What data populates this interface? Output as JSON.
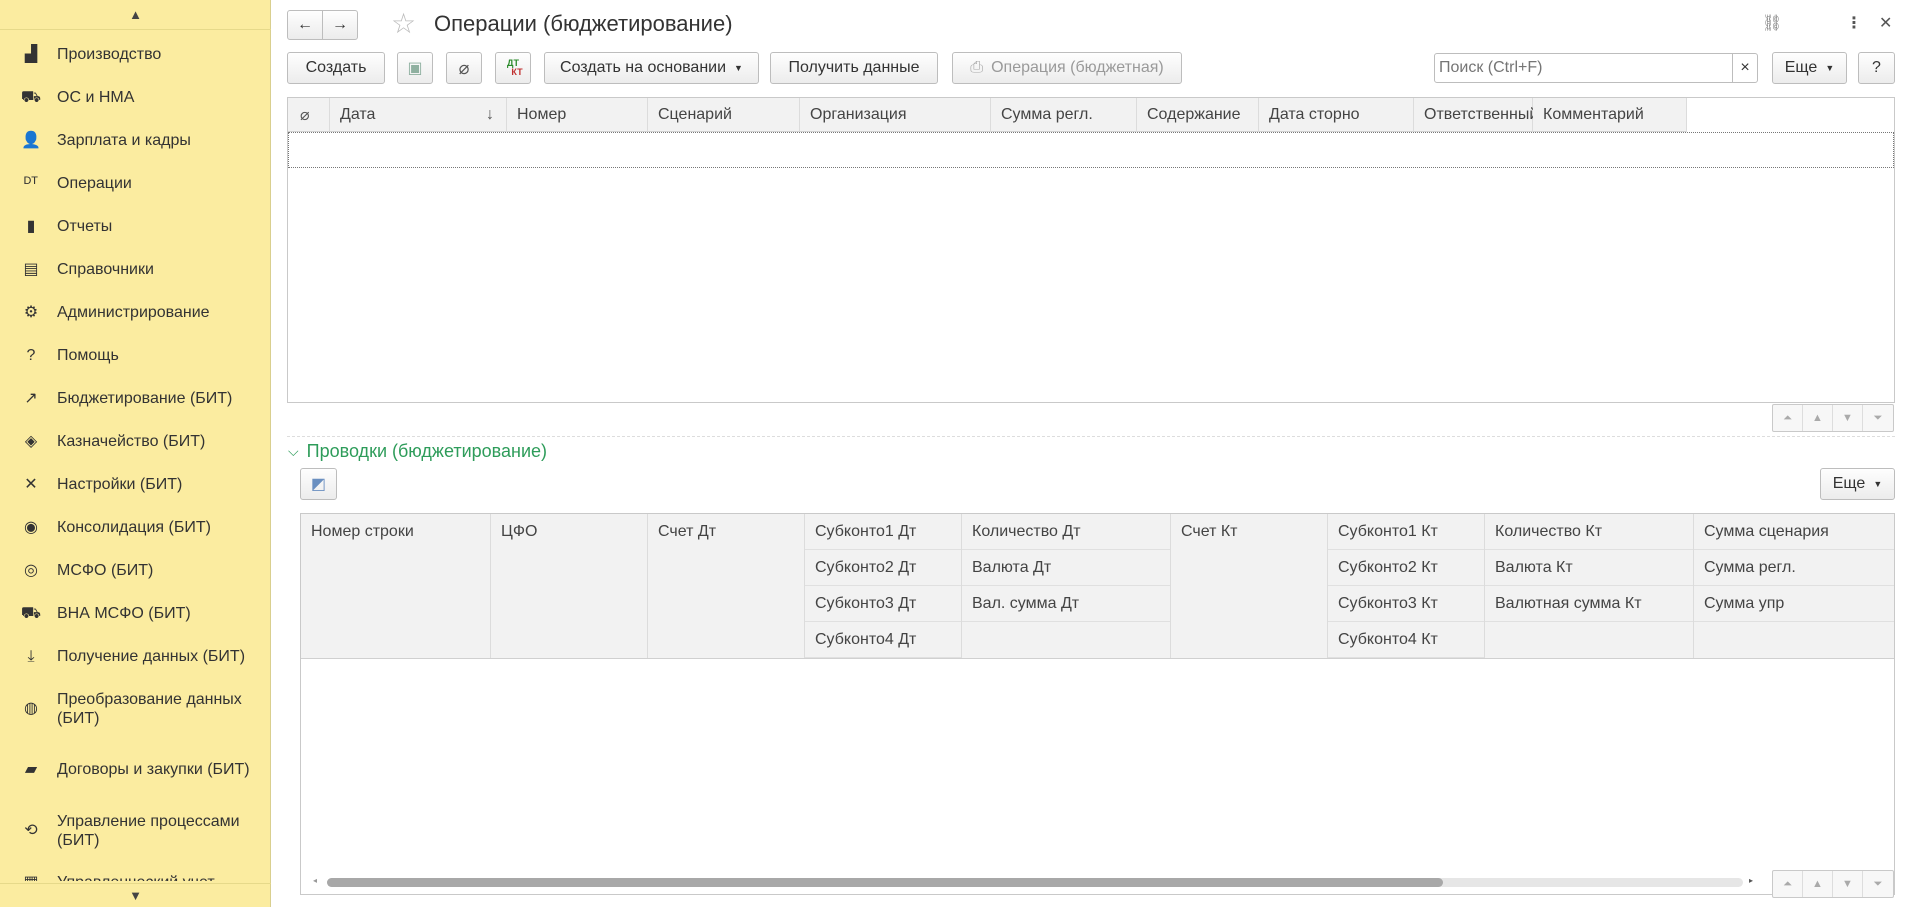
{
  "sidebar": {
    "items": [
      {
        "label": "Производство",
        "icon": "factory-icon",
        "glyph": "▟"
      },
      {
        "label": "ОС и НМА",
        "icon": "truck-icon",
        "glyph": "⛟"
      },
      {
        "label": "Зарплата и кадры",
        "icon": "person-icon",
        "glyph": "👤"
      },
      {
        "label": "Операции",
        "icon": "dt-kt-icon",
        "glyph": "ᴰᵀ"
      },
      {
        "label": "Отчеты",
        "icon": "bar-chart-icon",
        "glyph": "▮"
      },
      {
        "label": "Справочники",
        "icon": "books-icon",
        "glyph": "▤"
      },
      {
        "label": "Администрирование",
        "icon": "gear-icon",
        "glyph": "⚙"
      },
      {
        "label": "Помощь",
        "icon": "question-icon",
        "glyph": "?"
      },
      {
        "label": "Бюджетирование (БИТ)",
        "icon": "trend-chart-icon",
        "glyph": "↗"
      },
      {
        "label": "Казначейство (БИТ)",
        "icon": "money-icon",
        "glyph": "◈"
      },
      {
        "label": "Настройки (БИТ)",
        "icon": "tools-icon",
        "glyph": "✕"
      },
      {
        "label": "Консолидация (БИТ)",
        "icon": "globe-dark-icon",
        "glyph": "◉"
      },
      {
        "label": "МСФО (БИТ)",
        "icon": "globe-icon",
        "glyph": "◎"
      },
      {
        "label": "ВНА МСФО (БИТ)",
        "icon": "truck-icon",
        "glyph": "⛟"
      },
      {
        "label": "Получение данных (БИТ)",
        "icon": "download-icon",
        "glyph": "⤓"
      },
      {
        "label": "Преобразование данных (БИТ)",
        "icon": "transform-icon",
        "glyph": "◍",
        "tall": true
      },
      {
        "label": "Договоры и закупки (БИТ)",
        "icon": "folder-icon",
        "glyph": "▰",
        "tall": true
      },
      {
        "label": "Управление процессами (БИТ)",
        "icon": "process-icon",
        "glyph": "⟲",
        "tall": true
      },
      {
        "label": "Управленческий учет",
        "icon": "accounting-icon",
        "glyph": "▦"
      }
    ]
  },
  "header": {
    "title": "Операции (бюджетирование)",
    "back": "←",
    "forward": "→",
    "star": "☆",
    "link": "🔗",
    "more": "⋮",
    "close": "✕"
  },
  "toolbar": {
    "create": "Создать",
    "dt_kt": "Дт Кт",
    "create_based": "Создать на основании",
    "get_data": "Получить данные",
    "print_op": "Операция (бюджетная)",
    "search_placeholder": "Поиск (Ctrl+F)",
    "clear": "×",
    "more": "Еще",
    "help": "?"
  },
  "main_table": {
    "columns": [
      "Дата",
      "Номер",
      "Сценарий",
      "Организация",
      "Сумма регл.",
      "Содержание",
      "Дата сторно",
      "Ответственный",
      "Комментарий"
    ],
    "sort_arrow": "↓"
  },
  "entries": {
    "title": "Проводки (бюджетирование)",
    "more": "Еще",
    "col1": "Номер строки",
    "col2": "ЦФО",
    "col3": "Счет Дт",
    "col4": [
      "Субконто1 Дт",
      "Субконто2 Дт",
      "Субконто3 Дт",
      "Субконто4 Дт"
    ],
    "col5": [
      "Количество Дт",
      "Валюта Дт",
      "Вал. сумма Дт"
    ],
    "col6": "Счет Кт",
    "col7": [
      "Субконто1 Кт",
      "Субконто2 Кт",
      "Субконто3 Кт",
      "Субконто4 Кт"
    ],
    "col8": [
      "Количество Кт",
      "Валюта Кт",
      "Валютная сумма Кт"
    ],
    "col9": [
      "Сумма сценария",
      "Сумма регл.",
      "Сумма упр"
    ]
  },
  "colors": {
    "sidebar_bg": "#fbeca0",
    "accent_green": "#2e9c5a"
  }
}
